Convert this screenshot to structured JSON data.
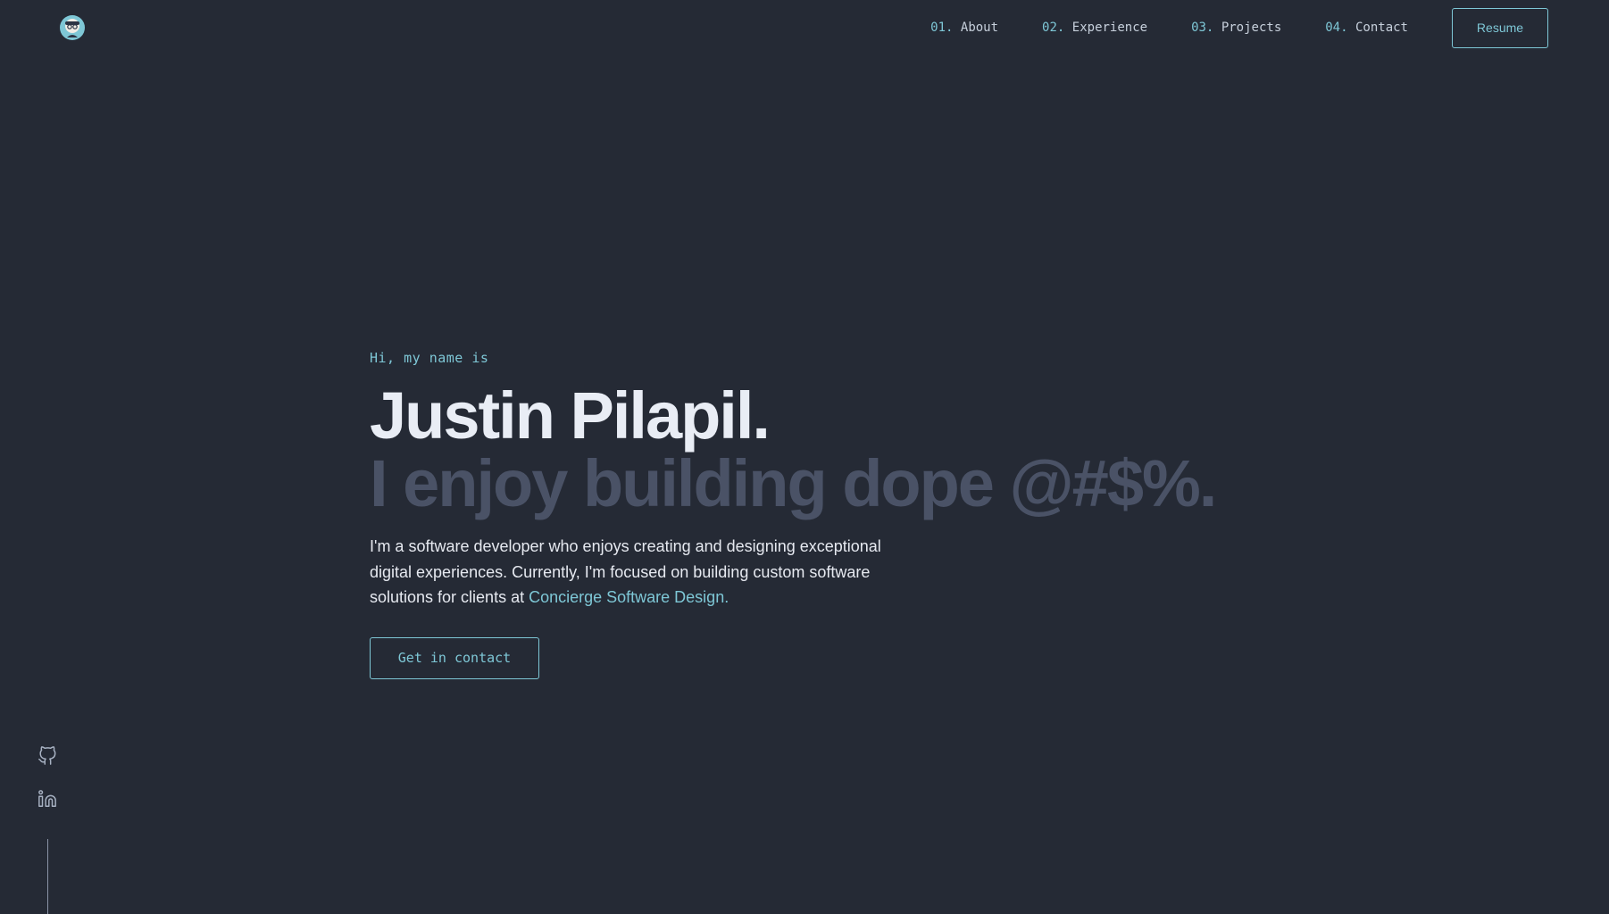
{
  "header": {
    "logo_alt": "avatar",
    "nav": [
      {
        "num": "01.",
        "label": "About"
      },
      {
        "num": "02.",
        "label": "Experience"
      },
      {
        "num": "03.",
        "label": "Projects"
      },
      {
        "num": "04.",
        "label": "Contact"
      }
    ],
    "resume_label": "Resume"
  },
  "hero": {
    "intro": "Hi, my name is",
    "name": "Justin Pilapil.",
    "tagline": "I enjoy building dope @#$%.",
    "description": "I'm a software developer who enjoys creating and designing exceptional digital experiences. Currently, I'm focused on building custom software solutions for clients at ",
    "company_link": "Concierge Software Design.",
    "contact_button": "Get in contact"
  },
  "social": {
    "icons": [
      "github-icon",
      "linkedin-icon"
    ]
  },
  "colors": {
    "background": "#252a35",
    "accent": "#7ec7d6",
    "heading": "#e9edf5",
    "muted_heading": "#4a5266"
  }
}
